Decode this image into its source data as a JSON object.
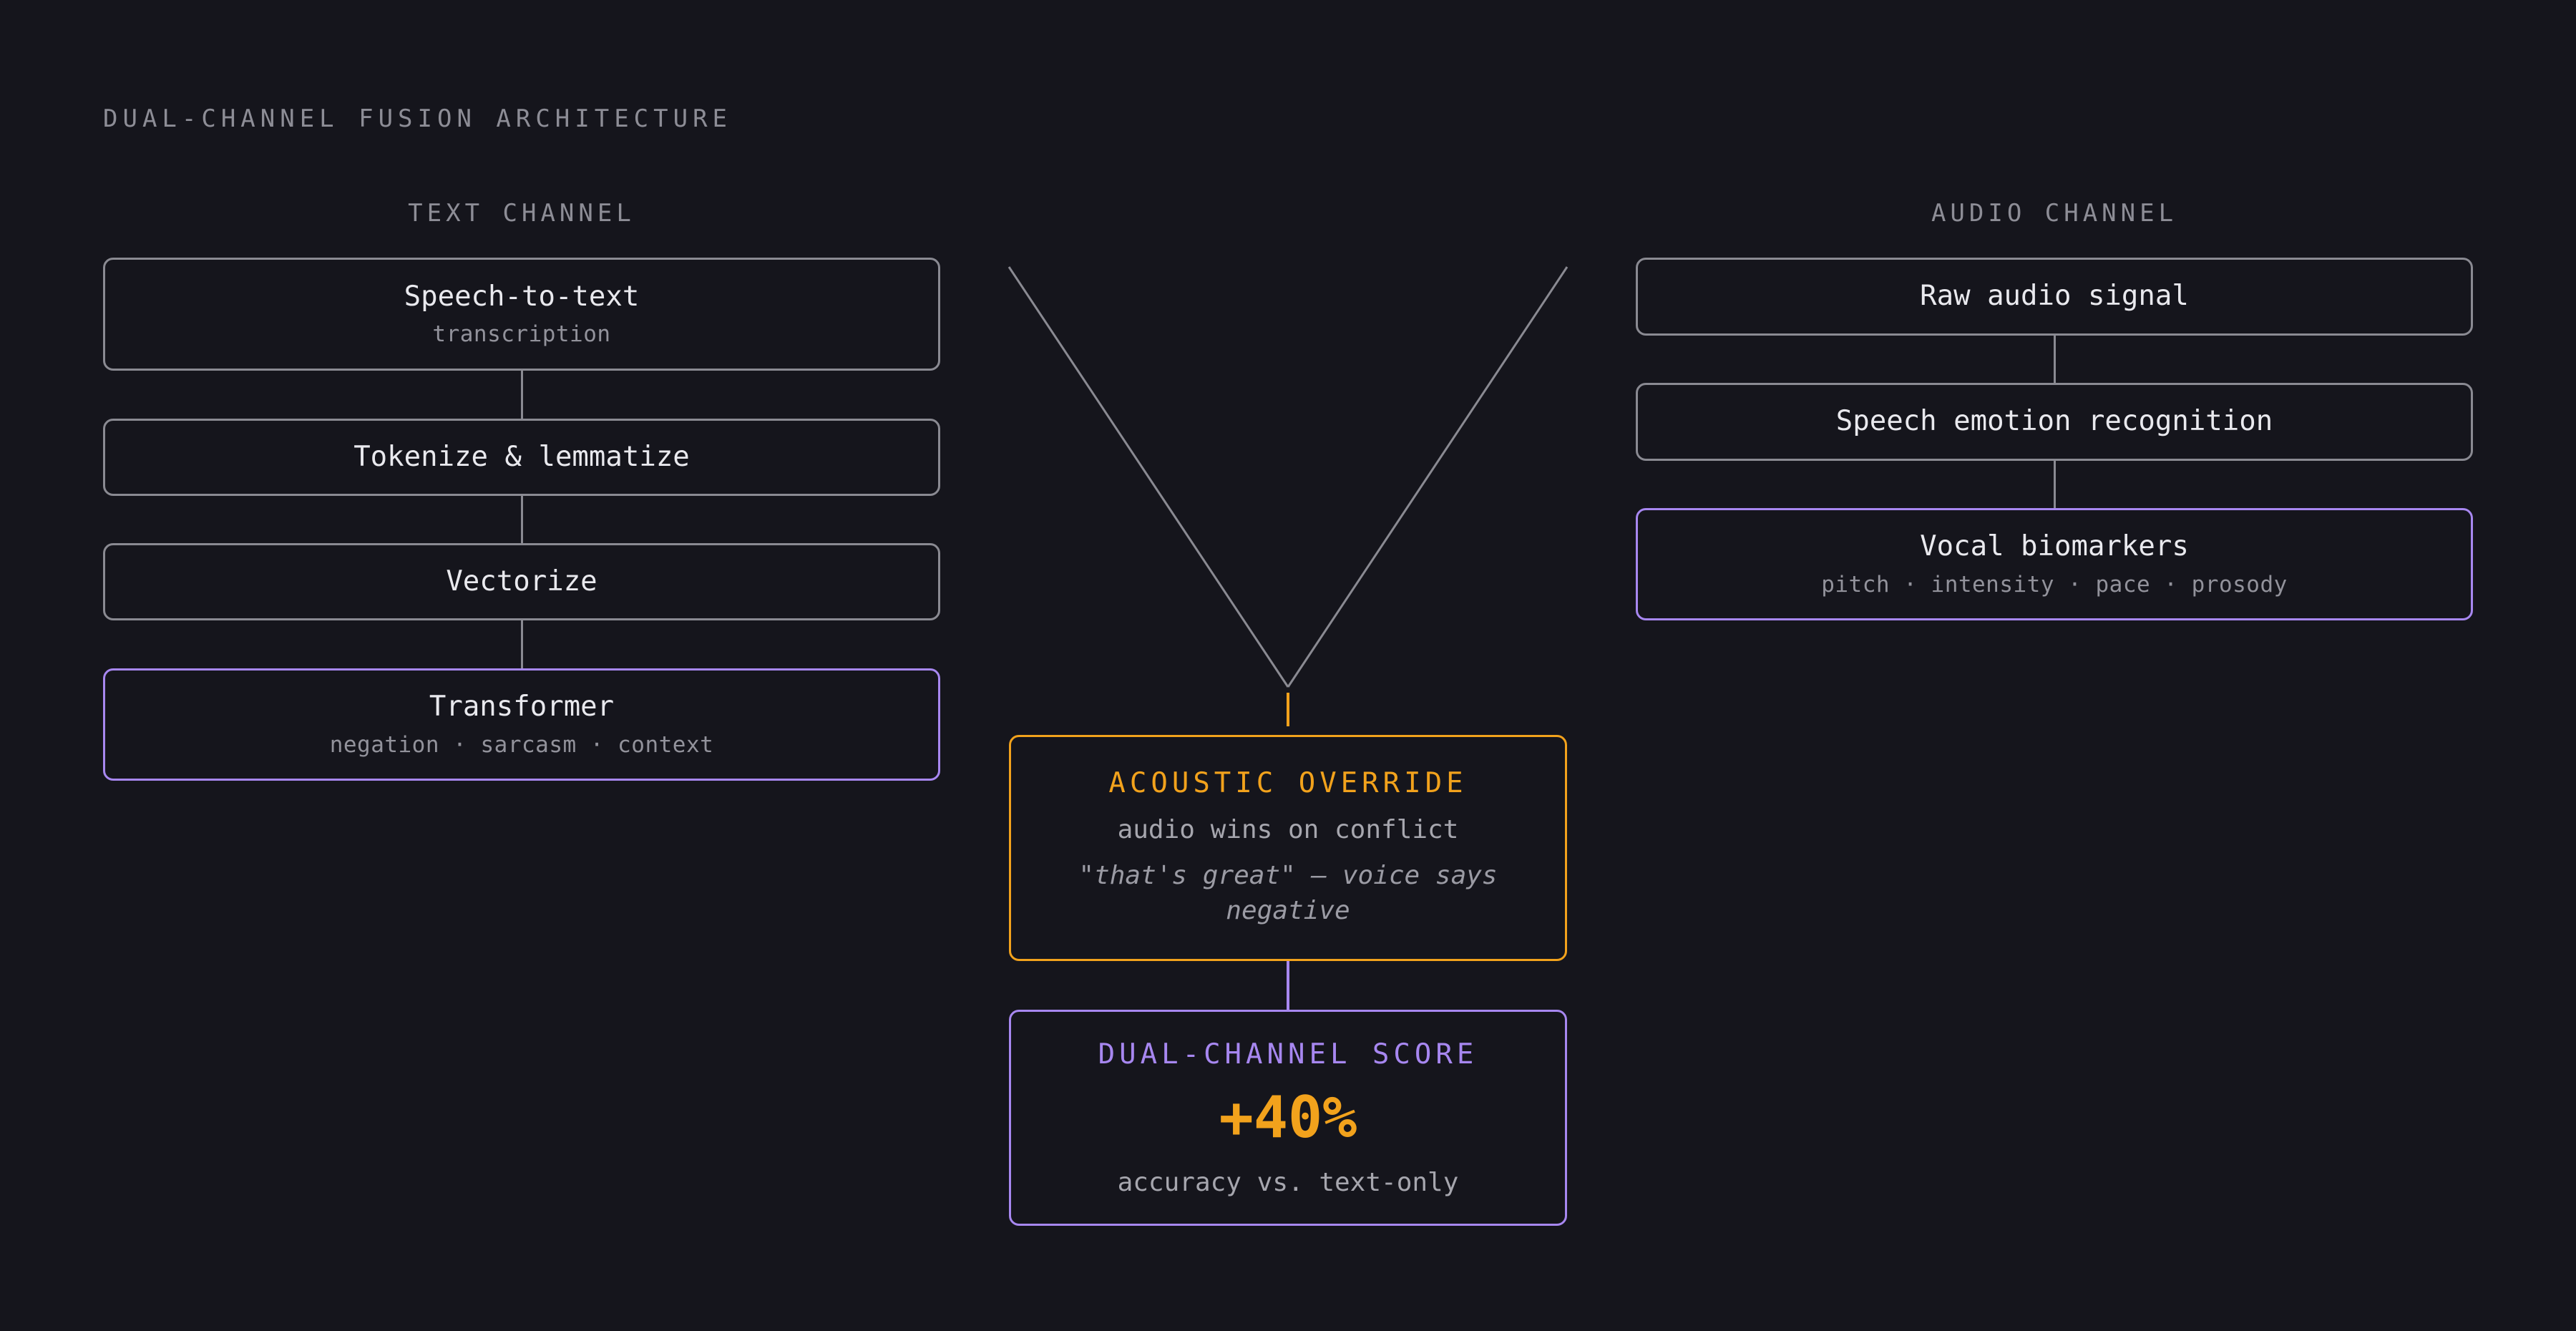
{
  "title": "DUAL-CHANNEL FUSION ARCHITECTURE",
  "text_channel": {
    "label": "TEXT CHANNEL",
    "steps": [
      {
        "name": "Speech-to-text",
        "sub": "transcription"
      },
      {
        "name": "Tokenize & lemmatize"
      },
      {
        "name": "Vectorize"
      },
      {
        "name": "Transformer",
        "sub": "negation · sarcasm · context"
      }
    ]
  },
  "audio_channel": {
    "label": "AUDIO CHANNEL",
    "steps": [
      {
        "name": "Raw audio signal"
      },
      {
        "name": "Speech emotion recognition"
      },
      {
        "name": "Vocal biomarkers",
        "sub": "pitch · intensity · pace · prosody"
      }
    ]
  },
  "override": {
    "title": "ACOUSTIC OVERRIDE",
    "subtitle": "audio wins on conflict",
    "example": "\"that's great\" — voice says negative"
  },
  "score": {
    "title": "DUAL-CHANNEL SCORE",
    "value": "+40%",
    "caption": "accuracy vs. text-only"
  },
  "colors": {
    "background": "#15151c",
    "neutral_border": "#8a8a92",
    "accent_purple": "#a787f0",
    "accent_orange": "#f2a21c"
  }
}
